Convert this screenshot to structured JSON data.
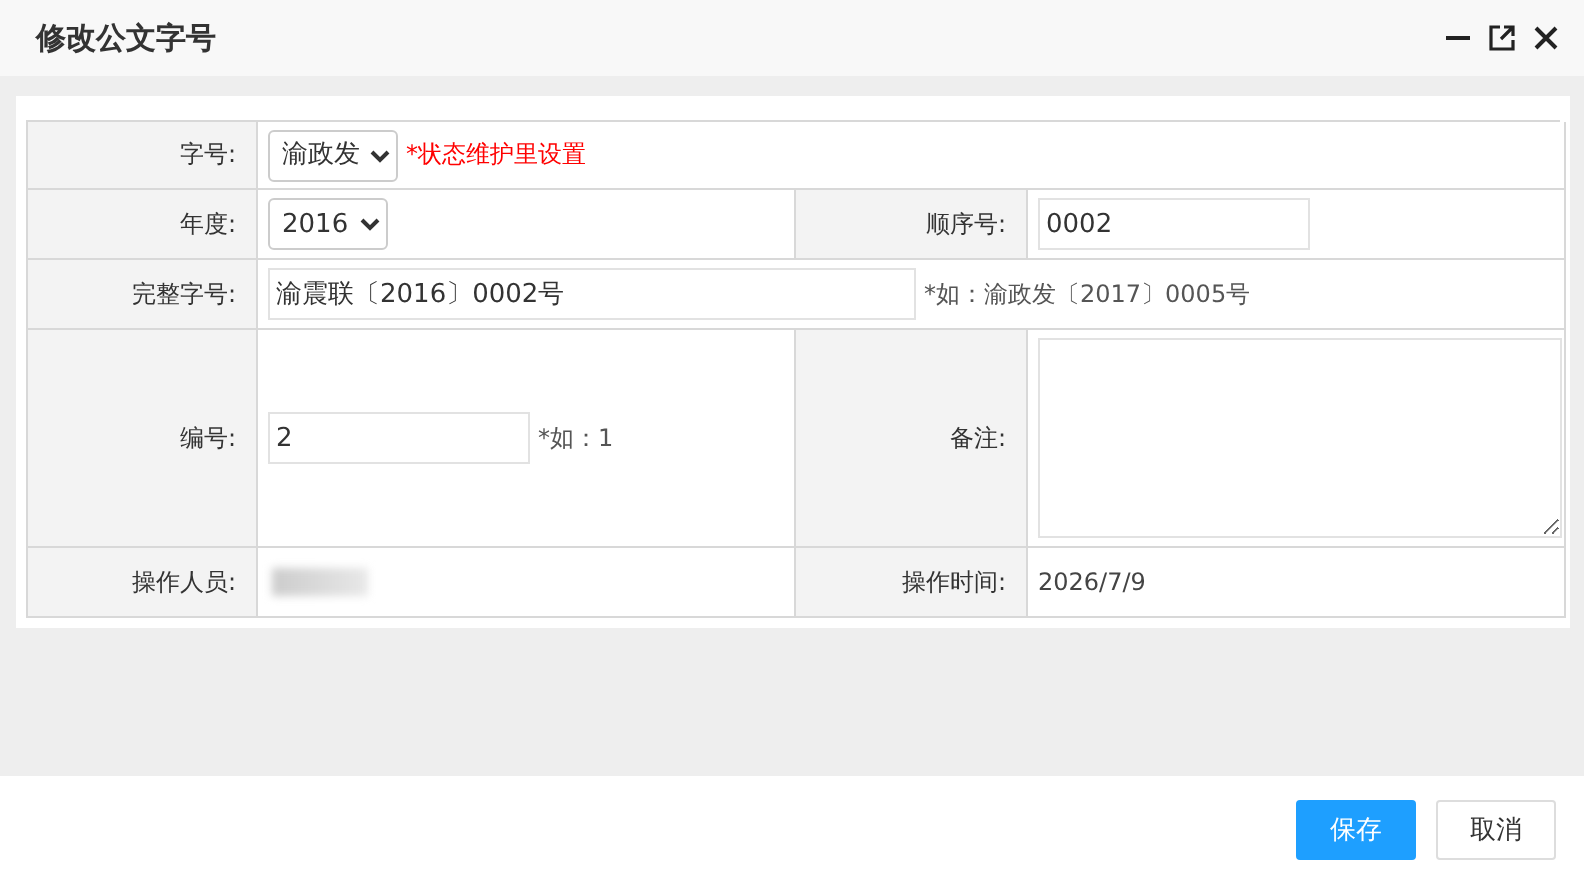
{
  "window": {
    "title": "修改公文字号"
  },
  "form": {
    "prefix": {
      "label": "字号:",
      "value": "渝政发",
      "hint": "*状态维护里设置"
    },
    "year": {
      "label": "年度:",
      "value": "2016"
    },
    "sequence": {
      "label": "顺序号:",
      "value": "0002"
    },
    "full_number": {
      "label": "完整字号:",
      "value": "渝震联〔2016〕0002号",
      "hint": "*如：渝政发〔2017〕0005号"
    },
    "number": {
      "label": "编号:",
      "value": "2",
      "hint": "*如：1"
    },
    "remark": {
      "label": "备注:"
    },
    "operator": {
      "label": "操作人员:"
    },
    "time": {
      "label": "操作时间:",
      "value": "2026/7/9"
    }
  },
  "buttons": [
    {
      "label": "保存",
      "kind": "primary"
    },
    {
      "label": "取消",
      "kind": "default"
    }
  ]
}
